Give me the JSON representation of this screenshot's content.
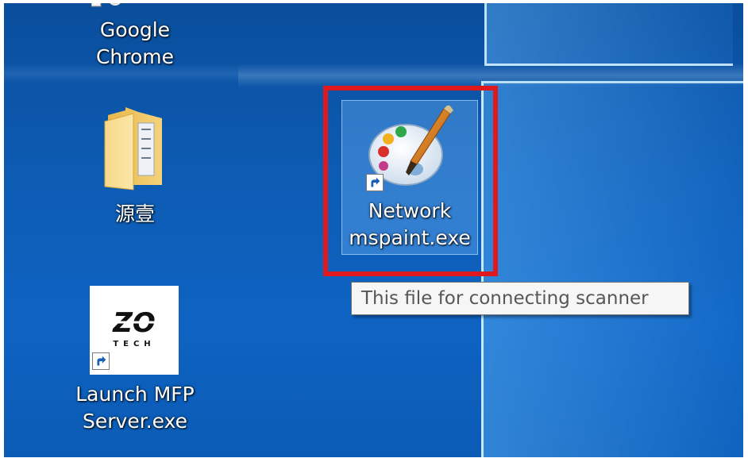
{
  "desktop": {
    "icons": [
      {
        "label": "Google\nChrome",
        "icon": "chrome-icon"
      },
      {
        "label": "源壹",
        "icon": "folder-icon"
      },
      {
        "label": "Network\nmspaint.exe",
        "icon": "paint-palette-icon",
        "selected": true,
        "shortcut": true
      },
      {
        "label": "Launch MFP\nServer.exe",
        "icon": "zo-tech-icon",
        "shortcut": true
      }
    ],
    "tooltip": "This file for connecting scanner",
    "zo_logo": {
      "main": "ZO",
      "sub": "TECH"
    }
  },
  "colors": {
    "desktop_blue": "#0d5cb4",
    "highlight_red": "#e0191e",
    "tooltip_bg": "#f6f6f6",
    "tooltip_text": "#575757"
  }
}
